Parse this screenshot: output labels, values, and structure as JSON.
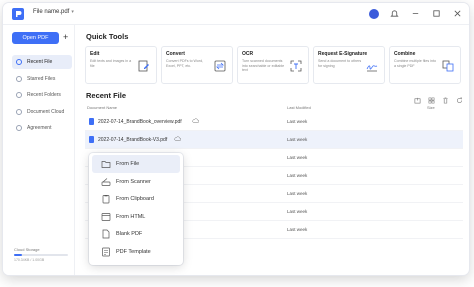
{
  "titlebar": {
    "doc_title": "File name.pdf",
    "icons": [
      "avatar-icon",
      "bell-icon",
      "minimize-icon",
      "maximize-icon",
      "close-icon"
    ]
  },
  "sidebar": {
    "open_label": "Open PDF",
    "plus_label": "+",
    "items": [
      {
        "label": "Recent File",
        "icon": "clock-icon",
        "active": true
      },
      {
        "label": "Starred Files",
        "icon": "star-icon",
        "active": false
      },
      {
        "label": "Recent Folders",
        "icon": "folder-icon",
        "active": false
      },
      {
        "label": "Document Cloud",
        "icon": "cloud-icon",
        "active": false
      },
      {
        "label": "Agreement",
        "icon": "agreement-icon",
        "active": false
      }
    ],
    "storage": {
      "label": "Cloud Storage",
      "amount": "170.34KB / 1.00GB",
      "fraction": 0.15
    }
  },
  "quick_tools": {
    "title": "Quick Tools",
    "cards": [
      {
        "title": "Edit",
        "desc": "Edit texts and images in a file",
        "icon": "edit-icon"
      },
      {
        "title": "Convert",
        "desc": "Convert PDFs to Word, Excel, PPT, etc.",
        "icon": "convert-icon"
      },
      {
        "title": "OCR",
        "desc": "Turn scanned documents into searchable or editable text",
        "icon": "ocr-icon"
      },
      {
        "title": "Request E-Signature",
        "desc": "Send a document to others for signing",
        "icon": "signature-icon"
      },
      {
        "title": "Combine",
        "desc": "Combine multiple files into a single PDF",
        "icon": "combine-icon"
      }
    ]
  },
  "recent": {
    "title": "Recent File",
    "columns": {
      "name": "Document Name",
      "modified": "Last Modified",
      "size": "Size"
    },
    "rows": [
      {
        "name": "2022-07-14_BrandBook_overview.pdf",
        "modified": "Last week",
        "size": "",
        "selected": false
      },
      {
        "name": "2022-07-14_BrandBook-V3.pdf",
        "modified": "Last week",
        "size": "",
        "selected": true
      },
      {
        "name": "",
        "modified": "Last week",
        "size": "",
        "selected": false
      },
      {
        "name": "",
        "modified": "Last week",
        "size": "",
        "selected": false
      },
      {
        "name": "",
        "modified": "Last week",
        "size": "",
        "selected": false
      },
      {
        "name": "",
        "modified": "Last week",
        "size": "",
        "selected": false
      },
      {
        "name": "",
        "modified": "Last week",
        "size": "",
        "selected": false
      }
    ]
  },
  "create_menu": {
    "items": [
      {
        "label": "From File",
        "icon": "folder-icon",
        "hover": true
      },
      {
        "label": "From Scanner",
        "icon": "scanner-icon",
        "hover": false
      },
      {
        "label": "From Clipboard",
        "icon": "clipboard-icon",
        "hover": false
      },
      {
        "label": "From HTML",
        "icon": "html-icon",
        "hover": false
      },
      {
        "label": "Blank PDF",
        "icon": "blank-pdf-icon",
        "hover": false
      },
      {
        "label": "PDF Template",
        "icon": "template-icon",
        "hover": false
      }
    ]
  },
  "colors": {
    "accent": "#3e6ff6",
    "selected_row": "#eef2fb",
    "active_nav": "#e8edf9"
  }
}
